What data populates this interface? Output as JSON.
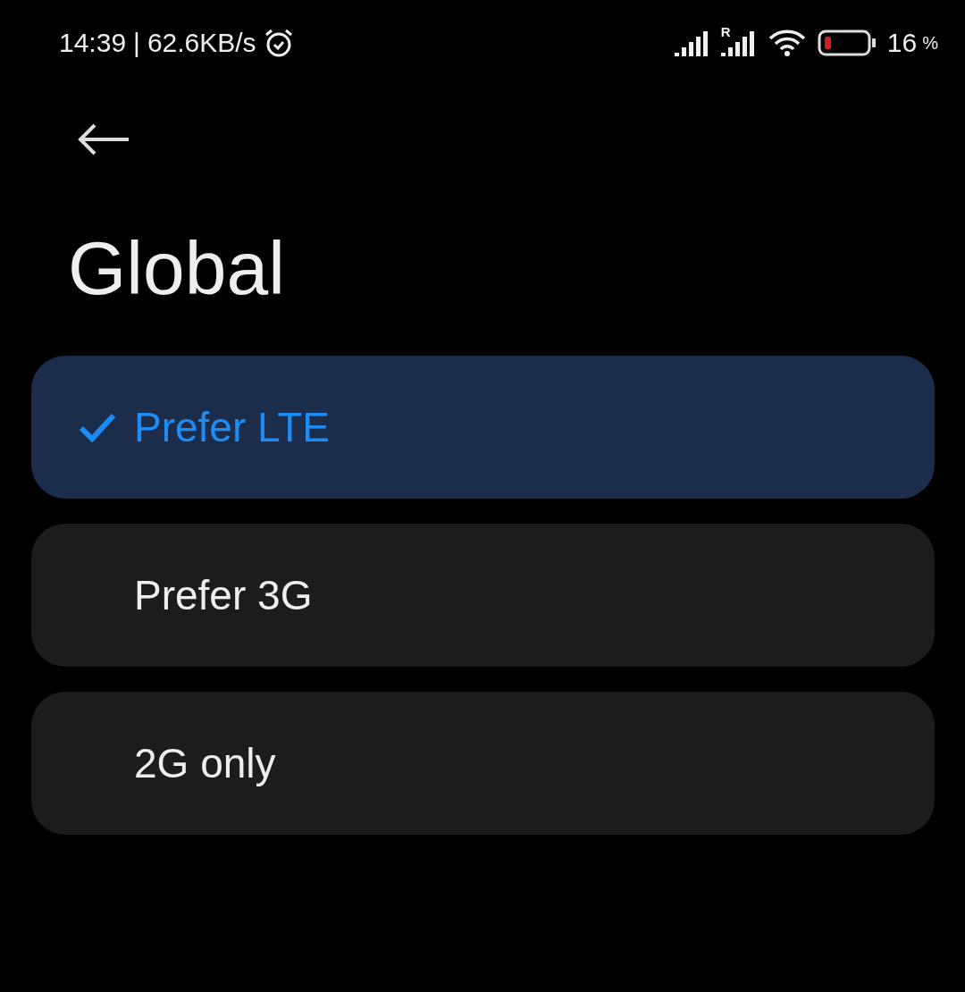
{
  "status_bar": {
    "time": "14:39",
    "separator": "|",
    "speed": "62.6KB/s",
    "roaming": "R",
    "battery_percent": "16",
    "percent_sign": "%"
  },
  "title": "Global",
  "options": [
    {
      "label": "Prefer LTE",
      "selected": true
    },
    {
      "label": "Prefer 3G",
      "selected": false
    },
    {
      "label": "2G only",
      "selected": false
    }
  ]
}
